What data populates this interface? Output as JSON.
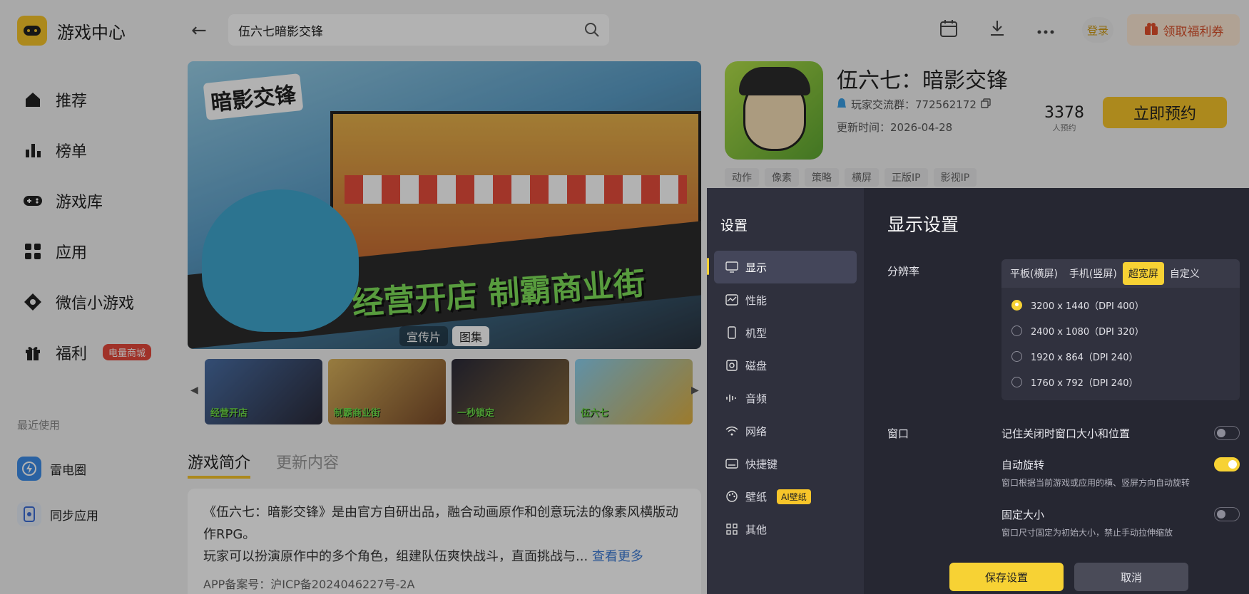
{
  "app": {
    "title": "游戏中心"
  },
  "sidebar": {
    "items": [
      {
        "label": "推荐",
        "icon": "home-icon"
      },
      {
        "label": "榜单",
        "icon": "chart-icon"
      },
      {
        "label": "游戏库",
        "icon": "gamepad-icon"
      },
      {
        "label": "应用",
        "icon": "apps-icon"
      },
      {
        "label": "微信小游戏",
        "icon": "wechat-game-icon"
      },
      {
        "label": "福利",
        "icon": "gift-icon",
        "badge": "电量商城"
      }
    ],
    "recent_title": "最近使用",
    "recent": [
      {
        "label": "雷电圈",
        "icon": "leidian-circle-icon"
      },
      {
        "label": "同步应用",
        "icon": "sync-app-icon"
      }
    ]
  },
  "topbar": {
    "search_value": "伍六七暗影交锋",
    "login": "登录",
    "coupon": "领取福利券"
  },
  "banner": {
    "logo_text": "暗影交锋",
    "slogan": "经营开店 制霸商业街",
    "tabs": [
      "宣传片",
      "图集"
    ],
    "active_tab": "图集"
  },
  "thumbnails": [
    "经营开店",
    "制霸商业街",
    "一秒锁定",
    "伍六七"
  ],
  "game": {
    "title": "伍六七：暗影交锋",
    "group": "玩家交流群：772562172",
    "updated": "更新时间：2026-04-28",
    "reserve_count": "3378",
    "reserve_count_label": "人预约",
    "reserve_button": "立即预约",
    "tags": [
      "动作",
      "像素",
      "策略",
      "横屏",
      "正版IP",
      "影视IP"
    ]
  },
  "content": {
    "tabs": [
      "游戏简介",
      "更新内容"
    ],
    "desc_line1": "《伍六七：暗影交锋》是由官方自研出品，融合动画原作和创意玩法的像素风横版动作RPG。",
    "desc_line2": "玩家可以扮演原作中的多个角色，组建队伍爽快战斗，直面挑战与...",
    "more": "查看更多",
    "icp": "APP备案号：沪ICP备2024046227号-2A"
  },
  "settings": {
    "title": "设置",
    "nav": [
      {
        "label": "显示",
        "icon": "monitor-icon"
      },
      {
        "label": "性能",
        "icon": "performance-icon"
      },
      {
        "label": "机型",
        "icon": "phone-icon"
      },
      {
        "label": "磁盘",
        "icon": "disk-icon"
      },
      {
        "label": "音频",
        "icon": "audio-icon"
      },
      {
        "label": "网络",
        "icon": "wifi-icon"
      },
      {
        "label": "快捷键",
        "icon": "keyboard-icon"
      },
      {
        "label": "壁纸",
        "icon": "palette-icon",
        "badge": "AI壁纸"
      },
      {
        "label": "其他",
        "icon": "grid-icon"
      }
    ],
    "active_nav": "显示",
    "main_title": "显示设置",
    "resolution_label": "分辨率",
    "res_tabs": [
      "平板(横屏)",
      "手机(竖屏)",
      "超宽屏",
      "自定义"
    ],
    "active_res_tab": "超宽屏",
    "res_options": [
      "3200 x 1440（DPI 400）",
      "2400 x 1080（DPI 320）",
      "1920 x 864（DPI 240）",
      "1760 x 792（DPI 240）"
    ],
    "selected_res": "3200 x 1440（DPI 400）",
    "window_label": "窗口",
    "window_options": [
      {
        "title": "记住关闭时窗口大小和位置",
        "desc": "",
        "on": false
      },
      {
        "title": "自动旋转",
        "desc": "窗口根据当前游戏或应用的横、竖屏方向自动旋转",
        "on": true
      },
      {
        "title": "固定大小",
        "desc": "窗口尺寸固定为初始大小，禁止手动拉伸缩放",
        "on": false
      }
    ],
    "save": "保存设置",
    "cancel": "取消"
  },
  "colors": {
    "accent": "#f7d234",
    "panel": "#262732",
    "panel_nav": "#2f303d",
    "badge_red": "#e5483b"
  }
}
